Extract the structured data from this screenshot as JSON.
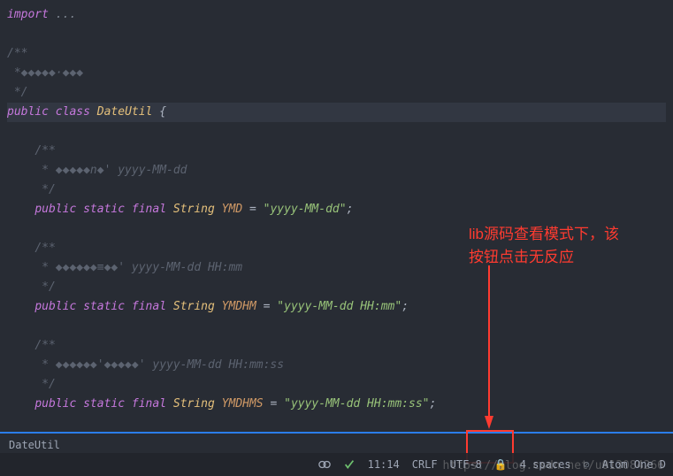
{
  "code": {
    "import_kw": "import",
    "import_rest": " ...",
    "doc1_open": "/**",
    "doc1_body": " *◆◆◆◆◆·◆◆◆",
    "doc1_close": " */",
    "public": "public",
    "class": "class",
    "classname": "DateUtil",
    "lbrace": "{",
    "doc2_open": "/**",
    "doc2_body": " * ◆◆◆◆◆n◆' yyyy-MM-dd",
    "doc2_close": " */",
    "static": "static",
    "final": "final",
    "type_string": "String",
    "const1": "YMD",
    "eq": " = ",
    "val1": "\"yyyy-MM-dd\"",
    "semi": ";",
    "doc3_open": "/**",
    "doc3_body": " * ◆◆◆◆◆◆≡◆◆' yyyy-MM-dd HH:mm",
    "doc3_close": " */",
    "const2": "YMDHM",
    "val2": "\"yyyy-MM-dd HH:mm\"",
    "doc4_open": "/**",
    "doc4_body": " * ◆◆◆◆◆◆'◆◆◆◆◆' yyyy-MM-dd HH:mm:ss",
    "doc4_close": " */",
    "const3": "YMDHMS",
    "val3": "\"yyyy-MM-dd HH:mm:ss\""
  },
  "breadcrumb": "DateUtil",
  "annotation": {
    "line1": "lib源码查看模式下，该",
    "line2": "按钮点击无反应"
  },
  "status": {
    "time": "11:14",
    "line_ending": "CRLF",
    "encoding": "UTF-8",
    "indent": "4 spaces",
    "theme": "Atom One D"
  },
  "watermark": "https://blog.csdn.net/u013084266"
}
